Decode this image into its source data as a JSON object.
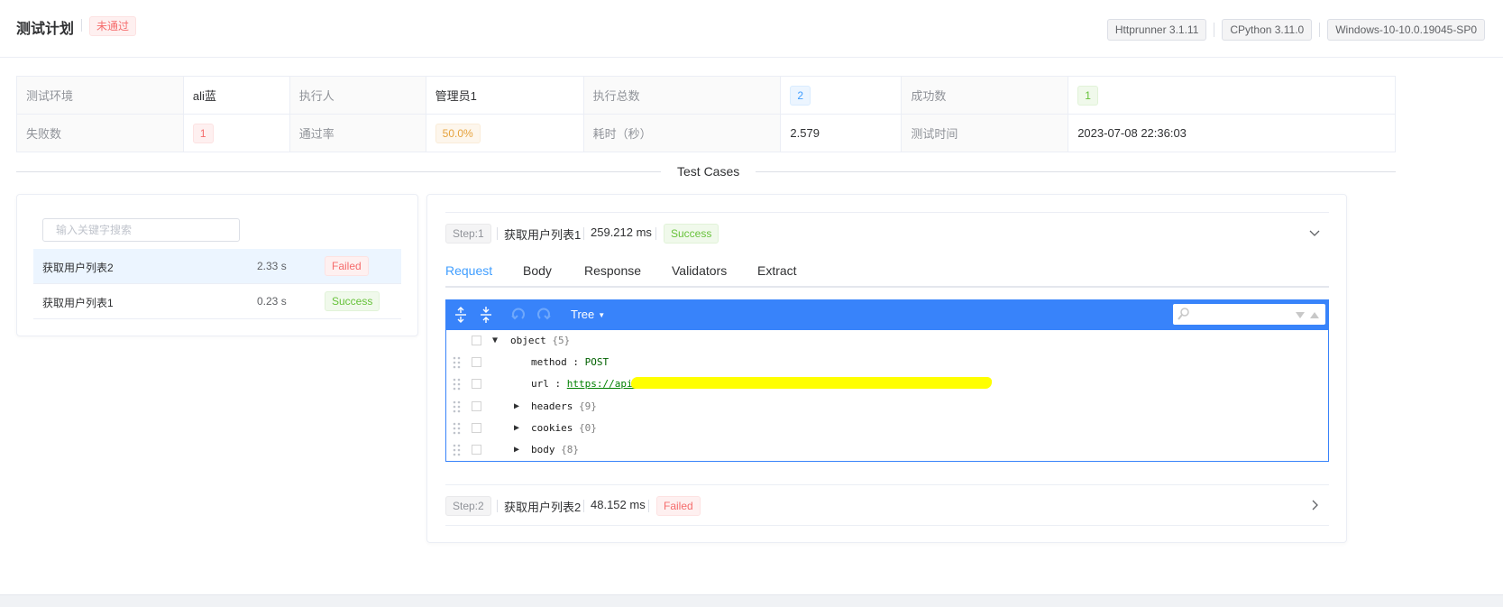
{
  "header": {
    "title": "测试计划",
    "status": "未通过",
    "env_tags": [
      "Httprunner 3.1.11",
      "CPython 3.11.0",
      "Windows-10-10.0.19045-SP0"
    ]
  },
  "summary": {
    "row1": [
      {
        "label": "测试环境",
        "value": "ali蓝"
      },
      {
        "label": "执行人",
        "value": "管理员1"
      },
      {
        "label": "执行总数",
        "value": "2"
      },
      {
        "label": "成功数",
        "value": "1"
      }
    ],
    "row2": [
      {
        "label": "失败数",
        "value": "1"
      },
      {
        "label": "通过率",
        "value": "50.0%"
      },
      {
        "label": "耗时（秒）",
        "value": "2.579"
      },
      {
        "label": "测试时间",
        "value": "2023-07-08 22:36:03"
      }
    ]
  },
  "divider_text": "Test Cases",
  "case_list": {
    "search_placeholder": "输入关键字搜索",
    "items": [
      {
        "name": "获取用户列表2",
        "time": "2.33 s",
        "status": "Failed",
        "active": true
      },
      {
        "name": "获取用户列表1",
        "time": "0.23 s",
        "status": "Success",
        "active": false
      }
    ]
  },
  "steps": [
    {
      "label": "Step:1",
      "name": "获取用户列表1",
      "time": "259.212 ms",
      "status": "Success",
      "expanded": true
    },
    {
      "label": "Step:2",
      "name": "获取用户列表2",
      "time": "48.152 ms",
      "status": "Failed",
      "expanded": false
    }
  ],
  "tabs": [
    "Request",
    "Body",
    "Response",
    "Validators",
    "Extract"
  ],
  "active_tab": "Request",
  "json_editor": {
    "mode": "Tree",
    "root": {
      "key": "object",
      "count": "{5}"
    },
    "fields": [
      {
        "key": "method",
        "value": "POST"
      },
      {
        "key": "url",
        "value": "https://api.dev.aliyun.kuaiyangren.com/app/user/list?page=1&size=login"
      },
      {
        "key": "headers",
        "count": "{9}"
      },
      {
        "key": "cookies",
        "count": "{0}"
      },
      {
        "key": "body",
        "count": "{8}"
      }
    ]
  },
  "colors": {
    "primary": "#409eff",
    "editor_blue": "#3883fa",
    "success": "#67c23a",
    "danger": "#f56c6c",
    "warning": "#e6a23c"
  }
}
